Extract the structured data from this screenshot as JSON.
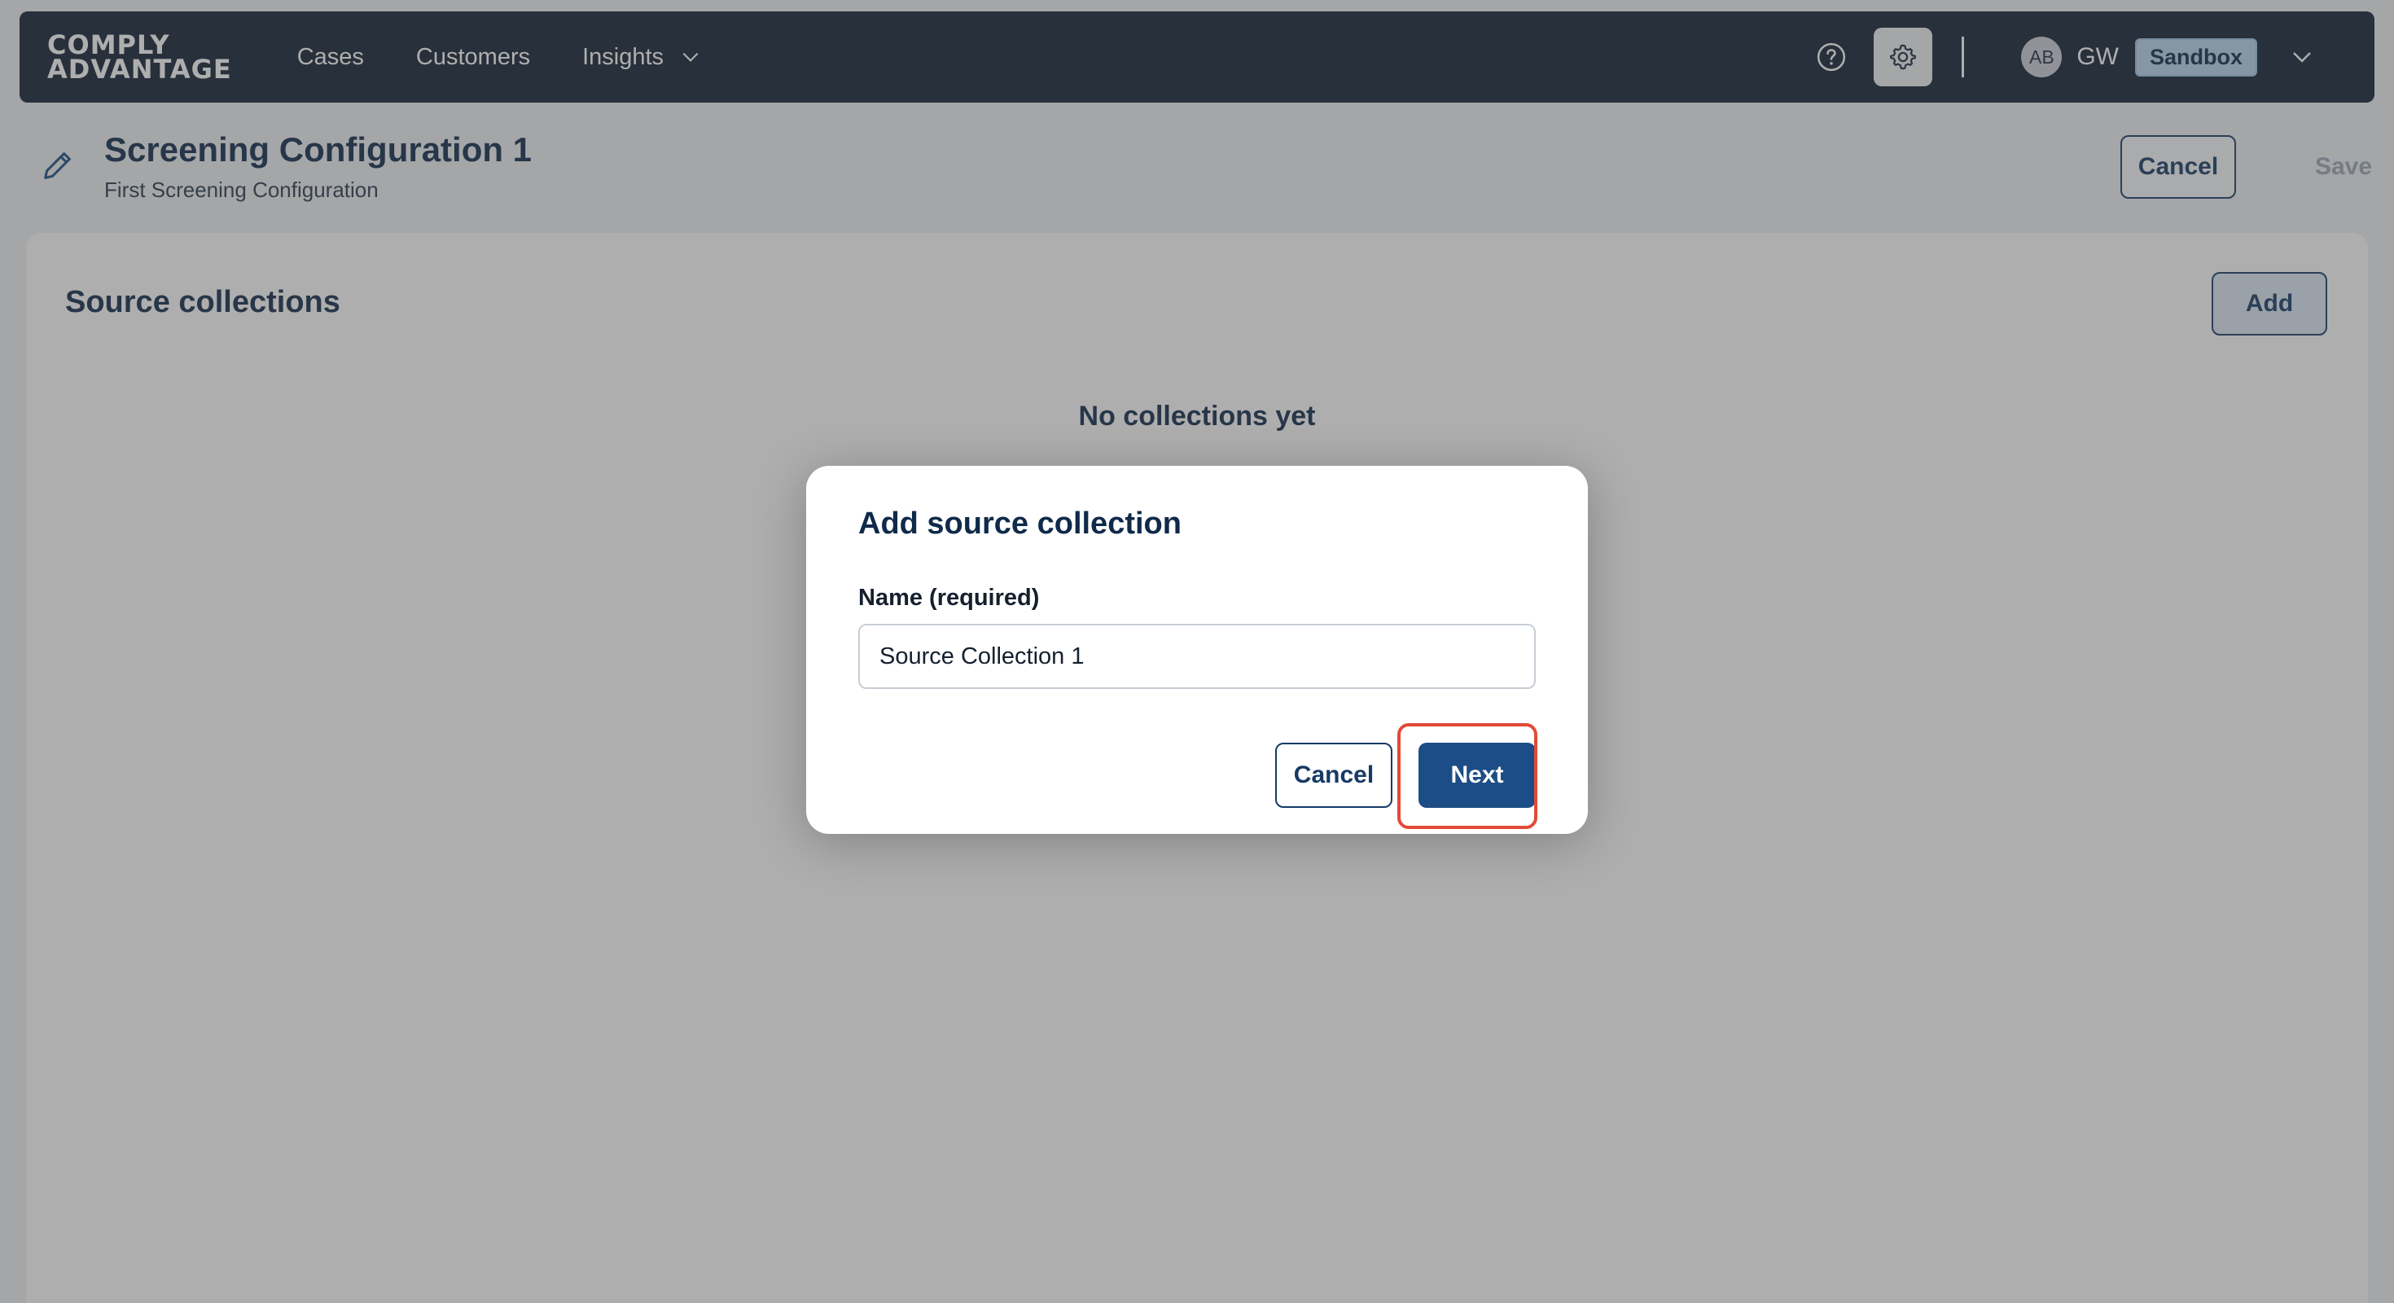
{
  "brand": {
    "logo_line1": "COMPLY",
    "logo_line2": "ADVANTAGE"
  },
  "nav": {
    "items": [
      {
        "label": "Cases"
      },
      {
        "label": "Customers"
      },
      {
        "label": "Insights"
      }
    ],
    "icons": {
      "help": "help-circle-icon",
      "settings": "gear-icon",
      "dropdown": "chevron-down-icon"
    },
    "user": {
      "avatar_initials": "AB",
      "initials": "GW",
      "environment_badge": "Sandbox"
    }
  },
  "header": {
    "title": "Screening Configuration 1",
    "subtitle": "First Screening Configuration",
    "cancel_label": "Cancel",
    "save_label": "Save"
  },
  "card": {
    "title": "Source collections",
    "add_label": "Add",
    "empty_state": "No collections yet"
  },
  "modal": {
    "title": "Add source collection",
    "name_label": "Name (required)",
    "name_value": "Source Collection 1",
    "cancel_label": "Cancel",
    "next_label": "Next"
  },
  "colors": {
    "nav_bg": "#0f1f33",
    "primary": "#1d4d86",
    "highlight": "#e24a36",
    "badge_bg": "#b8d4ee"
  }
}
